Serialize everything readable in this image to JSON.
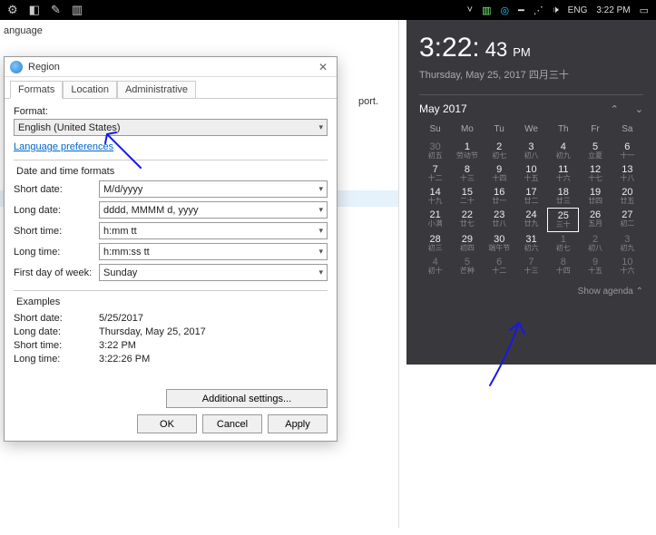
{
  "taskbar": {
    "icons_left": [
      "⚙",
      "🧩",
      "📰",
      "🗂"
    ],
    "battery": "▯",
    "circle": "◎",
    "net1": "━",
    "wifi": "⋰",
    "sound": "🔊",
    "lang": "ENG",
    "time": "3:22 PM",
    "notif": "▭"
  },
  "bg": {
    "title": "anguage",
    "port": "port."
  },
  "dialog": {
    "title": "Region",
    "tabs": [
      "Formats",
      "Location",
      "Administrative"
    ],
    "format_label": "Format:",
    "format_value": "English (United States)",
    "lang_prefs": "Language preferences",
    "dtf_label": "Date and time formats",
    "short_date_lbl": "Short date:",
    "short_date_val": "M/d/yyyy",
    "long_date_lbl": "Long date:",
    "long_date_val": "dddd, MMMM d, yyyy",
    "short_time_lbl": "Short time:",
    "short_time_val": "h:mm tt",
    "long_time_lbl": "Long time:",
    "long_time_val": "h:mm:ss tt",
    "first_day_lbl": "First day of week:",
    "first_day_val": "Sunday",
    "examples_hdr": "Examples",
    "ex_short_date_lbl": "Short date:",
    "ex_short_date_val": "5/25/2017",
    "ex_long_date_lbl": "Long date:",
    "ex_long_date_val": "Thursday, May 25, 2017",
    "ex_short_time_lbl": "Short time:",
    "ex_short_time_val": "3:22 PM",
    "ex_long_time_lbl": "Long time:",
    "ex_long_time_val": "3:22:26 PM",
    "additional": "Additional settings...",
    "ok": "OK",
    "cancel": "Cancel",
    "apply": "Apply"
  },
  "flyout": {
    "time_main": "3:22:",
    "time_sec": "43",
    "ampm": "PM",
    "date": "Thursday, May 25, 2017 四月三十",
    "month": "May 2017",
    "dow": [
      "Su",
      "Mo",
      "Tu",
      "We",
      "Th",
      "Fr",
      "Sa"
    ],
    "rows": [
      [
        {
          "n": "30",
          "s": "初五",
          "dim": true
        },
        {
          "n": "1",
          "s": "劳动节"
        },
        {
          "n": "2",
          "s": "初七"
        },
        {
          "n": "3",
          "s": "初八"
        },
        {
          "n": "4",
          "s": "初九"
        },
        {
          "n": "5",
          "s": "立夏"
        },
        {
          "n": "6",
          "s": "十一"
        }
      ],
      [
        {
          "n": "7",
          "s": "十二"
        },
        {
          "n": "8",
          "s": "十三"
        },
        {
          "n": "9",
          "s": "十四"
        },
        {
          "n": "10",
          "s": "十五"
        },
        {
          "n": "11",
          "s": "十六"
        },
        {
          "n": "12",
          "s": "十七"
        },
        {
          "n": "13",
          "s": "十八"
        }
      ],
      [
        {
          "n": "14",
          "s": "十九"
        },
        {
          "n": "15",
          "s": "二十"
        },
        {
          "n": "16",
          "s": "廿一"
        },
        {
          "n": "17",
          "s": "廿二"
        },
        {
          "n": "18",
          "s": "廿三"
        },
        {
          "n": "19",
          "s": "廿四"
        },
        {
          "n": "20",
          "s": "廿五"
        }
      ],
      [
        {
          "n": "21",
          "s": "小满"
        },
        {
          "n": "22",
          "s": "廿七"
        },
        {
          "n": "23",
          "s": "廿八"
        },
        {
          "n": "24",
          "s": "廿九"
        },
        {
          "n": "25",
          "s": "三十",
          "today": true
        },
        {
          "n": "26",
          "s": "五月"
        },
        {
          "n": "27",
          "s": "初二"
        }
      ],
      [
        {
          "n": "28",
          "s": "初三"
        },
        {
          "n": "29",
          "s": "初四"
        },
        {
          "n": "30",
          "s": "端午节"
        },
        {
          "n": "31",
          "s": "初六"
        },
        {
          "n": "1",
          "s": "初七",
          "dim": true
        },
        {
          "n": "2",
          "s": "初八",
          "dim": true
        },
        {
          "n": "3",
          "s": "初九",
          "dim": true
        }
      ],
      [
        {
          "n": "4",
          "s": "初十",
          "dim": true
        },
        {
          "n": "5",
          "s": "芒种",
          "dim": true
        },
        {
          "n": "6",
          "s": "十二",
          "dim": true
        },
        {
          "n": "7",
          "s": "十三",
          "dim": true
        },
        {
          "n": "8",
          "s": "十四",
          "dim": true
        },
        {
          "n": "9",
          "s": "十五",
          "dim": true
        },
        {
          "n": "10",
          "s": "十六",
          "dim": true
        }
      ]
    ],
    "agenda": "Show agenda  ⌃"
  }
}
